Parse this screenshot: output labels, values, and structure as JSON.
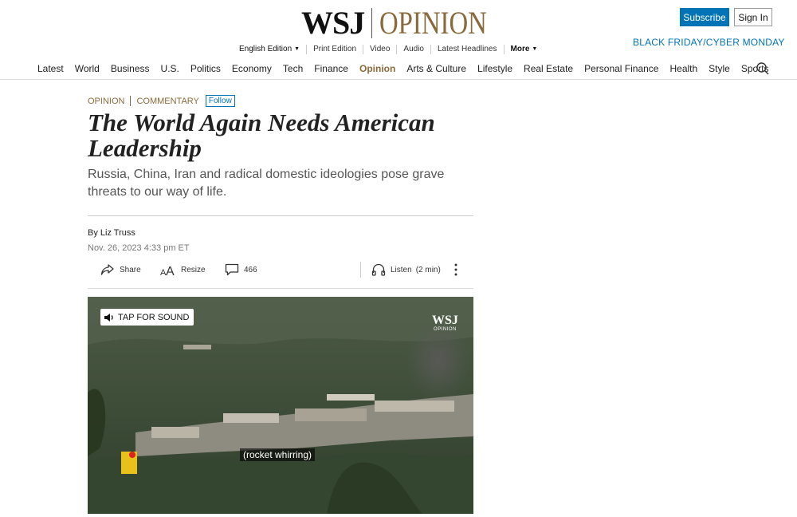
{
  "brand": {
    "wsj": "WSJ",
    "opinion": "OPINION"
  },
  "header": {
    "subscribe_label": "Subscribe",
    "signin_label": "Sign In",
    "promo": "BLACK FRIDAY/CYBER MONDAY",
    "subnav": [
      "English Edition",
      "Print Edition",
      "Video",
      "Audio",
      "Latest Headlines",
      "More"
    ]
  },
  "nav": {
    "items": [
      "Latest",
      "World",
      "Business",
      "U.S.",
      "Politics",
      "Economy",
      "Tech",
      "Finance",
      "Opinion",
      "Arts & Culture",
      "Lifestyle",
      "Real Estate",
      "Personal Finance",
      "Health",
      "Style",
      "Sports"
    ],
    "active": "Opinion"
  },
  "article": {
    "section": "OPINION",
    "category": "COMMENTARY",
    "follow_label": "Follow",
    "headline": "The World Again Needs American Leadership",
    "dek": "Russia, China, Iran and radical domestic ideologies pose grave threats to our way of life.",
    "byline": "By Liz Truss",
    "timestamp": "Nov. 26, 2023 4:33 pm ET",
    "tools": {
      "share": "Share",
      "resize": "Resize",
      "comments": "466",
      "listen": "Listen",
      "listen_duration": "(2 min)"
    }
  },
  "video": {
    "tap_label": "TAP FOR SOUND",
    "logo_main": "WSJ",
    "logo_sub": "OPINION",
    "caption": "(rocket whirring)"
  },
  "colors": {
    "accent_gold": "#8a6a3b",
    "link_blue": "#0274b6"
  }
}
